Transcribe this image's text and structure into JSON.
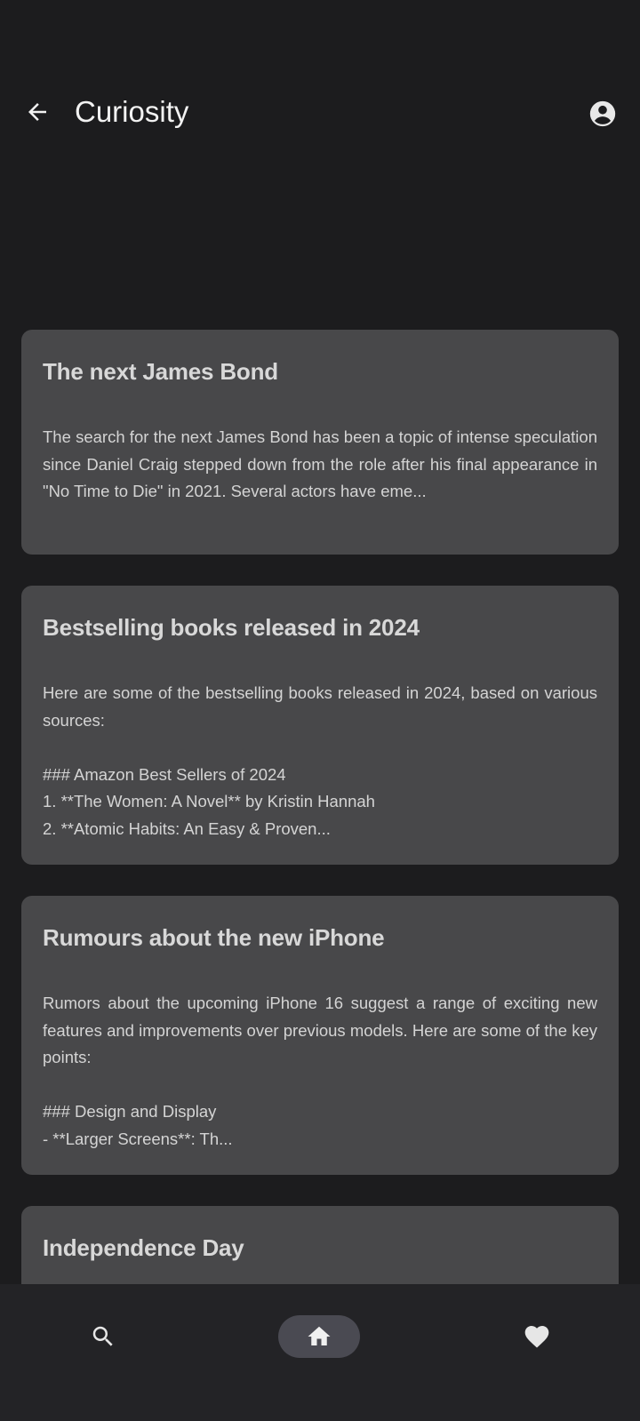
{
  "app": {
    "title": "Curiosity"
  },
  "icons": {
    "back": "arrow-back-icon",
    "account": "account-circle-icon",
    "search": "search-icon",
    "home": "home-icon",
    "favorites": "heart-icon"
  },
  "colors": {
    "background": "#1c1c1e",
    "card": "#48484a",
    "nav_bar": "#232326",
    "nav_active_pill": "#4a4a52",
    "icon": "#e6e6e6"
  },
  "cards": [
    {
      "title": "The next James Bond",
      "body": "The search for the next James Bond has been a topic of intense speculation since Daniel Craig stepped down from the role after his final appearance in \"No Time to Die\" in 2021. Several actors have eme..."
    },
    {
      "title": "Bestselling books released in 2024",
      "body": "Here are some of the bestselling books released in 2024, based on various sources:\n\n### Amazon Best Sellers of 2024\n1. **The Women: A Novel** by Kristin Hannah\n2. **Atomic Habits: An Easy & Proven..."
    },
    {
      "title": "Rumours about the new iPhone",
      "body": "Rumors about the upcoming iPhone 16 suggest a range of exciting new features and improvements over previous models. Here are some of the key points:\n\n### Design and Display\n- **Larger Screens**: Th..."
    },
    {
      "title": "Independence Day",
      "body": ""
    }
  ],
  "bottom_nav": {
    "active": "home"
  }
}
